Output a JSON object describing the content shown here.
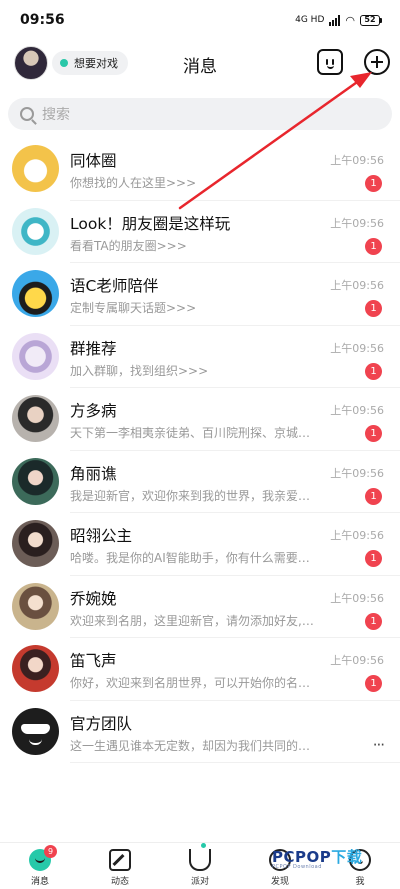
{
  "status_bar": {
    "time": "09:56",
    "network": "4G HD",
    "battery": "52"
  },
  "header": {
    "title": "消息",
    "status_pill": "想要对戏",
    "status_dot_color": "#29c7a8",
    "robot_icon": "robot-icon",
    "add_icon": "plus-circle-icon"
  },
  "search": {
    "placeholder": "搜索"
  },
  "chats": [
    {
      "name": "同体圈",
      "preview": "你想找的人在这里>>>",
      "time": "上午09:56",
      "unread": "1"
    },
    {
      "name": "Look！朋友圈是这样玩",
      "preview": "看看TA的朋友圈>>>",
      "time": "上午09:56",
      "unread": "1"
    },
    {
      "name": "语C老师陪伴",
      "preview": "定制专属聊天话题>>>",
      "time": "上午09:56",
      "unread": "1"
    },
    {
      "name": "群推荐",
      "preview": "加入群聊，找到组织>>>",
      "time": "上午09:56",
      "unread": "1"
    },
    {
      "name": "方多病",
      "preview": "天下第一李相夷亲徒弟、百川院刑探、京城…",
      "time": "上午09:56",
      "unread": "1"
    },
    {
      "name": "角丽谯",
      "preview": "我是迎新官，欢迎你来到我的世界，我亲爱…",
      "time": "上午09:56",
      "unread": "1"
    },
    {
      "name": "昭翎公主",
      "preview": "哈喽。我是你的AI智能助手，你有什么需要…",
      "time": "上午09:56",
      "unread": "1"
    },
    {
      "name": "乔婉娩",
      "preview": "欢迎来到名朋，这里迎新官，请勿添加好友,…",
      "time": "上午09:56",
      "unread": "1"
    },
    {
      "name": "笛飞声",
      "preview": "你好，欢迎来到名朋世界，可以开始你的名…",
      "time": "上午09:56",
      "unread": "1"
    },
    {
      "name": "官方团队",
      "preview": "这一生遇见谁本无定数，却因为我们共同的…",
      "time": "",
      "unread": "",
      "more": "···"
    }
  ],
  "bottom_nav": [
    {
      "label": "消息",
      "badge": "9"
    },
    {
      "label": "动态"
    },
    {
      "label": "派对"
    },
    {
      "label": "发现"
    },
    {
      "label": "我"
    }
  ],
  "watermark": {
    "brand": "PCPOP",
    "cn": "下载",
    "sub": "PCPOP Download"
  },
  "colors": {
    "accent": "#26c9a9",
    "badge": "#f0434f",
    "annotation_arrow": "#e8262d"
  }
}
